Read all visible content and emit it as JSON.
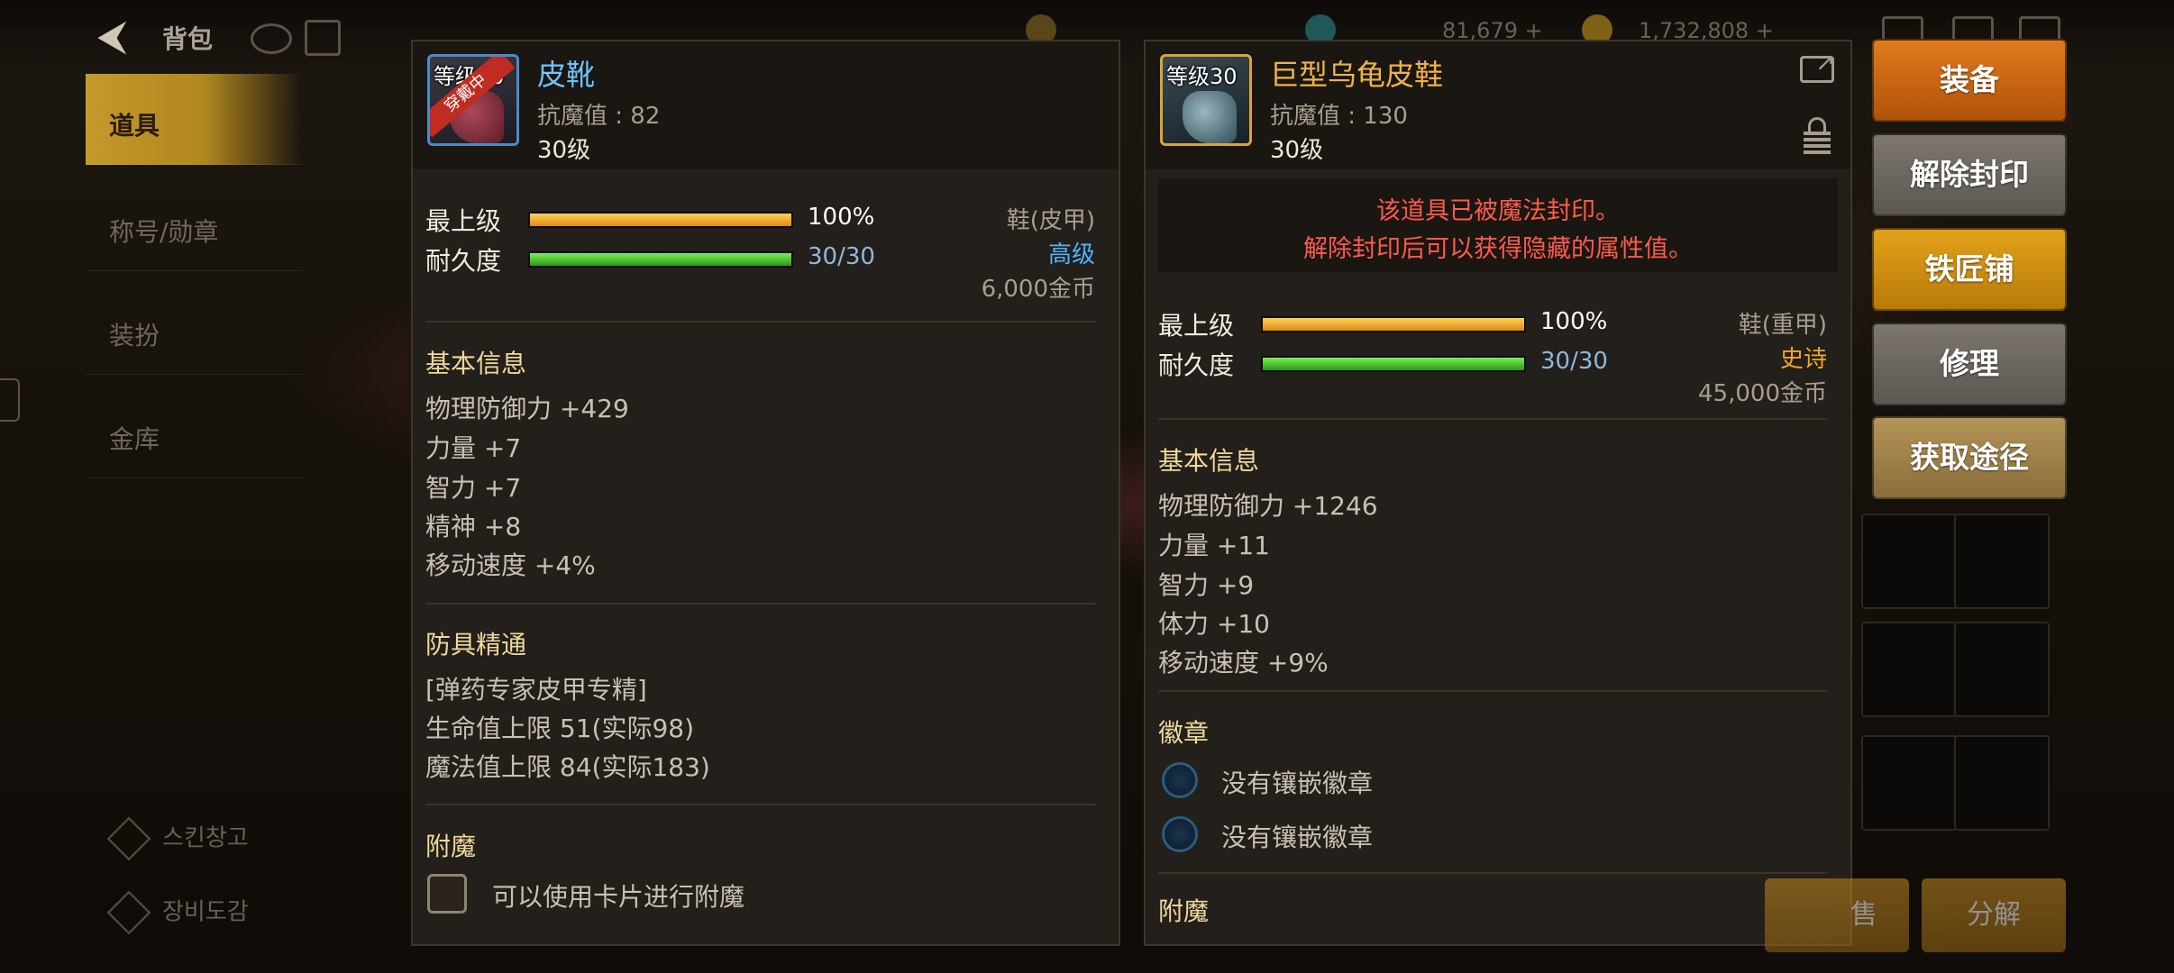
{
  "topbar": {
    "title": "背包",
    "currency_1": "81,679 +",
    "currency_2": "1,732,808 +"
  },
  "sidebar": {
    "items": [
      {
        "label": "道具"
      },
      {
        "label": "称号/勋章"
      },
      {
        "label": "装扮"
      },
      {
        "label": "金库"
      }
    ],
    "bottom_1": "스킨창고",
    "bottom_2": "장비도감"
  },
  "left_item": {
    "level_tag": "等级30",
    "wearing_tag": "穿戴中",
    "name": "皮靴",
    "resist": "抗魔值 : 82",
    "level_text": "30级",
    "top_grade_label": "最上级",
    "top_grade_value": "100%",
    "top_grade_pct": 100,
    "durability_label": "耐久度",
    "durability_value": "30/30",
    "durability_pct": 100,
    "type": "鞋(皮甲)",
    "rarity": "高级",
    "price": "6,000金币",
    "basic_title": "基本信息",
    "stats": [
      "物理防御力 +429",
      "力量 +7",
      "智力 +7",
      "精神 +8",
      "移动速度 +4%"
    ],
    "mastery_title": "防具精通",
    "mastery_lines": [
      "[弹药专家皮甲专精]",
      "生命值上限 51(实际98)",
      "魔法值上限 84(实际183)"
    ],
    "enchant_title": "附魔",
    "enchant_text": "可以使用卡片进行附魔"
  },
  "right_item": {
    "level_tag": "等级30",
    "name": "巨型乌龟皮鞋",
    "resist": "抗魔值 : 130",
    "level_text": "30级",
    "sealed_line_1": "该道具已被魔法封印。",
    "sealed_line_2": "解除封印后可以获得隐藏的属性值。",
    "top_grade_label": "最上级",
    "top_grade_value": "100%",
    "top_grade_pct": 100,
    "durability_label": "耐久度",
    "durability_value": "30/30",
    "durability_pct": 100,
    "type": "鞋(重甲)",
    "rarity": "史诗",
    "price": "45,000金币",
    "basic_title": "基本信息",
    "stats": [
      "物理防御力 +1246",
      "力量 +11",
      "智力 +9",
      "体力 +10",
      "移动速度 +9%"
    ],
    "emblem_title": "徽章",
    "emblem_slots": [
      "没有镶嵌徽章",
      "没有镶嵌徽章"
    ],
    "enchant_title": "附魔"
  },
  "actions": {
    "equip": "装备",
    "unseal": "解除封印",
    "blacksmith": "铁匠铺",
    "repair": "修理",
    "obtain": "获取途径",
    "disassemble": "分解",
    "bottom_left": "售"
  },
  "colors": {
    "rarity_high": "#4fb3ff",
    "rarity_epic": "#f0a62a",
    "sealed_text": "#ff5a4a",
    "section_title": "#f0d89c"
  }
}
